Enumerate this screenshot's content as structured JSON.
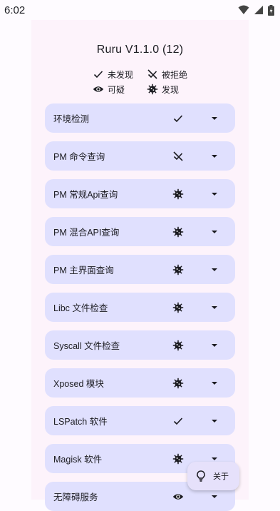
{
  "statusbar": {
    "time": "6:02"
  },
  "title": "Ruru V1.1.0 (12)",
  "legend": {
    "not_found": "未发现",
    "rejected": "被拒绝",
    "suspicious": "可疑",
    "found": "发现"
  },
  "checks": [
    {
      "label": "环境检测",
      "status": "not-found"
    },
    {
      "label": "PM 命令查询",
      "status": "rejected"
    },
    {
      "label": "PM 常规Api查询",
      "status": "found"
    },
    {
      "label": "PM 混合API查询",
      "status": "found"
    },
    {
      "label": "PM 主界面查询",
      "status": "found"
    },
    {
      "label": "Libc 文件检查",
      "status": "found"
    },
    {
      "label": "Syscall 文件检查",
      "status": "found"
    },
    {
      "label": "Xposed 模块",
      "status": "found"
    },
    {
      "label": "LSPatch 软件",
      "status": "not-found"
    },
    {
      "label": "Magisk 软件",
      "status": "found"
    },
    {
      "label": "无障碍服务",
      "status": "suspicious"
    }
  ],
  "fab": {
    "label": "关于",
    "icon": "lightbulb-icon"
  },
  "colors": {
    "card": "#e0e0fe",
    "surface": "#fdf3fb",
    "text": "#1b1b21",
    "fab": "#e6e1fb"
  }
}
